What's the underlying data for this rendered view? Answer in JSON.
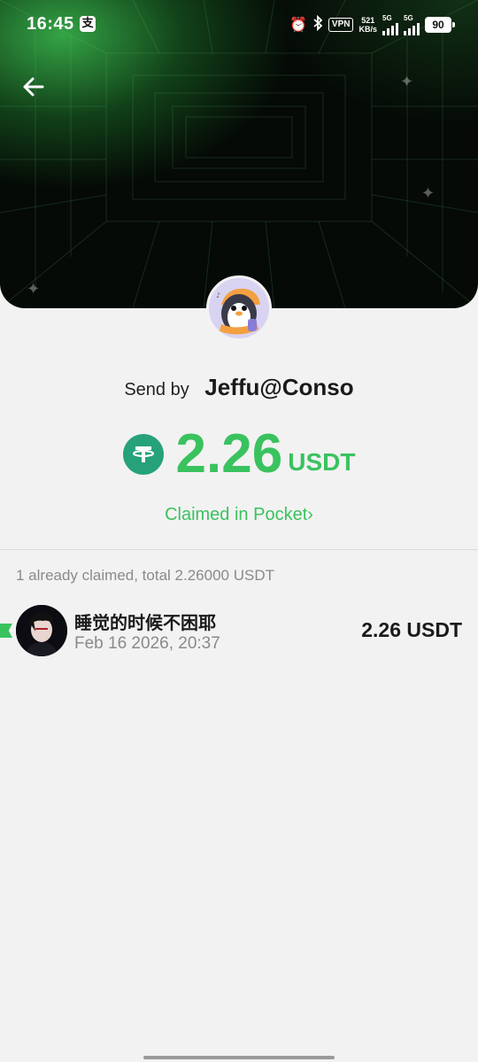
{
  "status_bar": {
    "time": "16:45",
    "app_icon_glyph": "支",
    "vpn": "VPN",
    "net_speed_value": "521",
    "net_speed_unit": "KB/s",
    "sim1_label": "5G",
    "sim2_label": "5G",
    "battery": "90"
  },
  "sender": {
    "label": "Send by",
    "name": "Jeffu@Conso"
  },
  "amount": {
    "value": "2.26",
    "unit": "USDT",
    "token_icon": "tether-icon"
  },
  "claimed_link": {
    "label": "Claimed in Pocket",
    "chevron": "›"
  },
  "summary": "1 already claimed, total 2.26000 USDT",
  "claims": [
    {
      "name": "睡觉的时候不困耶",
      "time": "Feb 16 2026, 20:37",
      "amount": "2.26 USDT"
    }
  ],
  "colors": {
    "accent": "#3ac25f",
    "usdt": "#26a17b",
    "background": "#f2f2f2",
    "hero_dark": "#050a06"
  }
}
